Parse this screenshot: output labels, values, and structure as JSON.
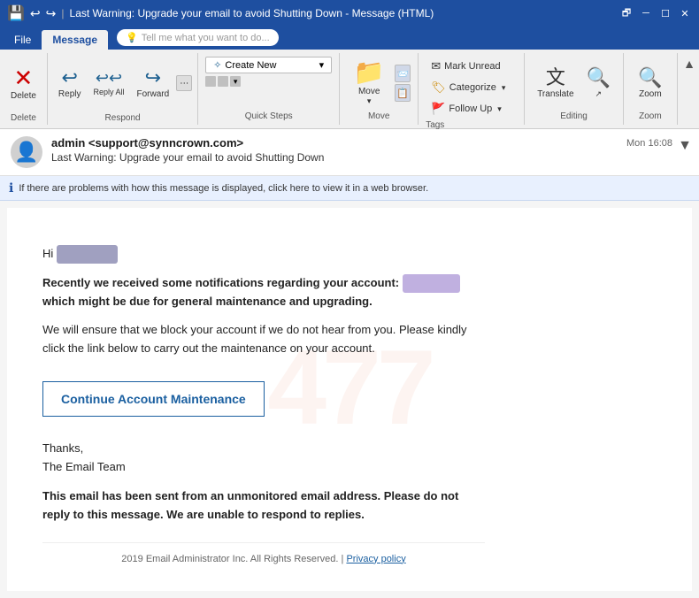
{
  "titlebar": {
    "title": "Last Warning: Upgrade your email to avoid Shutting Down - Message (HTML)",
    "controls": [
      "restore-icon",
      "minimize-icon",
      "maximize-icon",
      "close-icon"
    ]
  },
  "ribbon_tabs": {
    "tabs": [
      "File",
      "Message"
    ],
    "active_tab": "Message",
    "tell_me": "Tell me what you want to do..."
  },
  "ribbon": {
    "groups": {
      "delete": {
        "label": "Delete",
        "delete_btn": "Delete",
        "delete_icon": "✕"
      },
      "respond": {
        "label": "Respond",
        "reply_btn": "Reply",
        "reply_all_btn": "Reply All",
        "forward_btn": "Forward",
        "reply_icon": "↩",
        "reply_all_icon": "↩↩",
        "forward_icon": "↪"
      },
      "quick_steps": {
        "label": "Quick Steps",
        "create_new": "Create New",
        "expand_icon": "▼"
      },
      "move": {
        "label": "Move",
        "move_btn": "Move",
        "move_icon": "📁"
      },
      "tags": {
        "label": "Tags",
        "mark_unread": "Mark Unread",
        "categorize": "Categorize",
        "follow_up": "Follow Up",
        "flag_icon": "🚩",
        "tag_icon": "🏷"
      },
      "editing": {
        "label": "Editing",
        "translate_btn": "Translate",
        "search_btn": "🔍"
      },
      "zoom": {
        "label": "Zoom",
        "zoom_btn": "Zoom"
      }
    }
  },
  "email": {
    "sender": "admin <support@synncrown.com>",
    "sender_blurred": "support@synncrown.com",
    "subject": "Last Warning: Upgrade your email to avoid Shutting Down",
    "time": "Mon 16:08",
    "info_bar": "If there are problems with how this message is displayed, click here to view it in a web browser.",
    "greeting_blurred": "xxxxxxxxxxxx.xxx",
    "body_line1_pre": "Recently we received some notifications regarding your account:",
    "body_email_blurred": "xxxxxxx@xxxxx.xxx",
    "body_line1_post": "which might be due for general maintenance and upgrading.",
    "body_line2": "We will ensure that we block your account if we do not hear from you. Please kindly click the link below to carry out the maintenance on your account.",
    "cta_label": "Continue Account Maintenance",
    "sign_off1": "Thanks,",
    "sign_off2": "The Email Team",
    "disclaimer": "This email has been sent from an unmonitored email address. Please do not reply to this message. We are unable to respond to replies.",
    "footer": "2019 Email Administrator Inc. All Rights Reserved.",
    "footer_link": "Privacy policy"
  }
}
